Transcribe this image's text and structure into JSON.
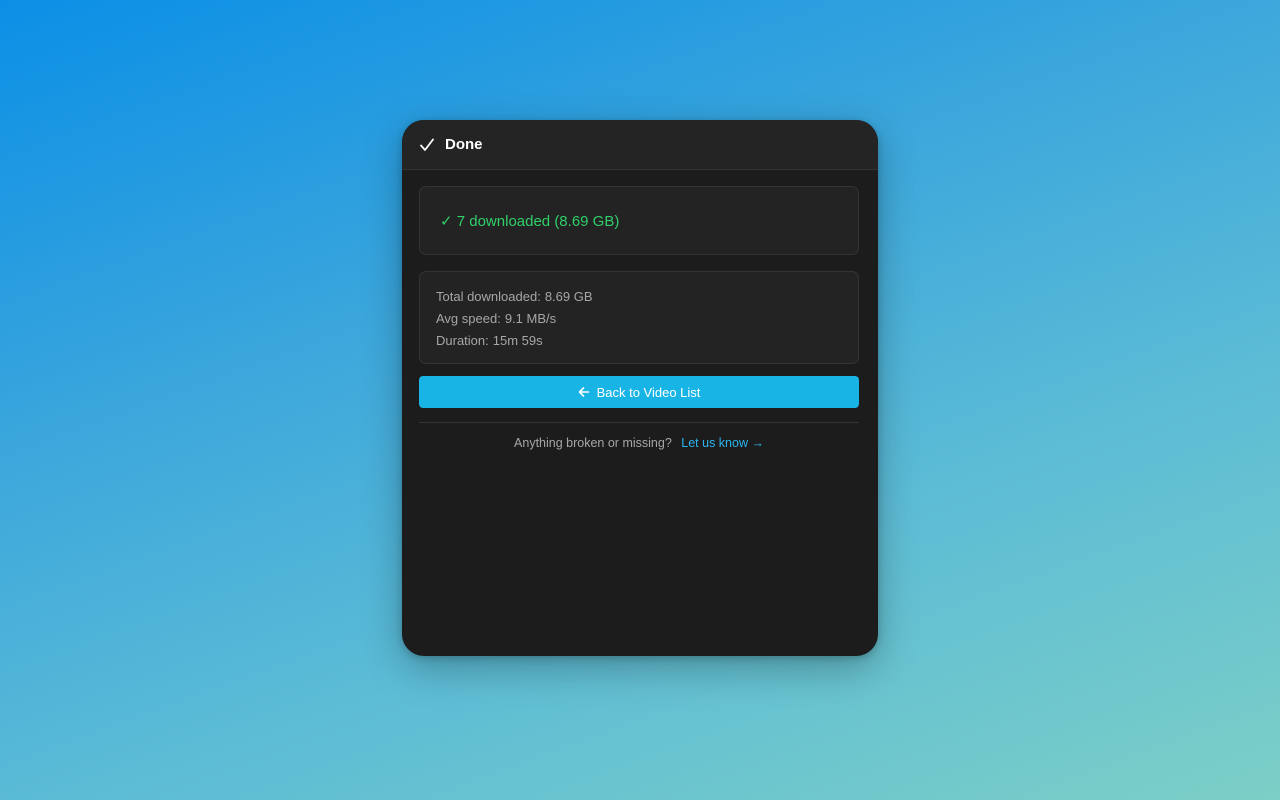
{
  "header": {
    "title": "Done",
    "icon": "checkmark-icon"
  },
  "status": {
    "text": "✓ 7 downloaded (8.69 GB)",
    "color": "#2fcf6a"
  },
  "stats": {
    "total_label": "Total downloaded:",
    "total_value": "8.69 GB",
    "speed_label": "Avg speed:",
    "speed_value": "9.1 MB/s",
    "duration_label": "Duration:",
    "duration_value": "15m 59s"
  },
  "actions": {
    "back_label": "Back to Video List",
    "back_icon": "arrow-left-icon",
    "accent_color": "#19b4e6"
  },
  "feedback": {
    "prompt": "Anything broken or missing?",
    "link_label": "Let us know →"
  }
}
